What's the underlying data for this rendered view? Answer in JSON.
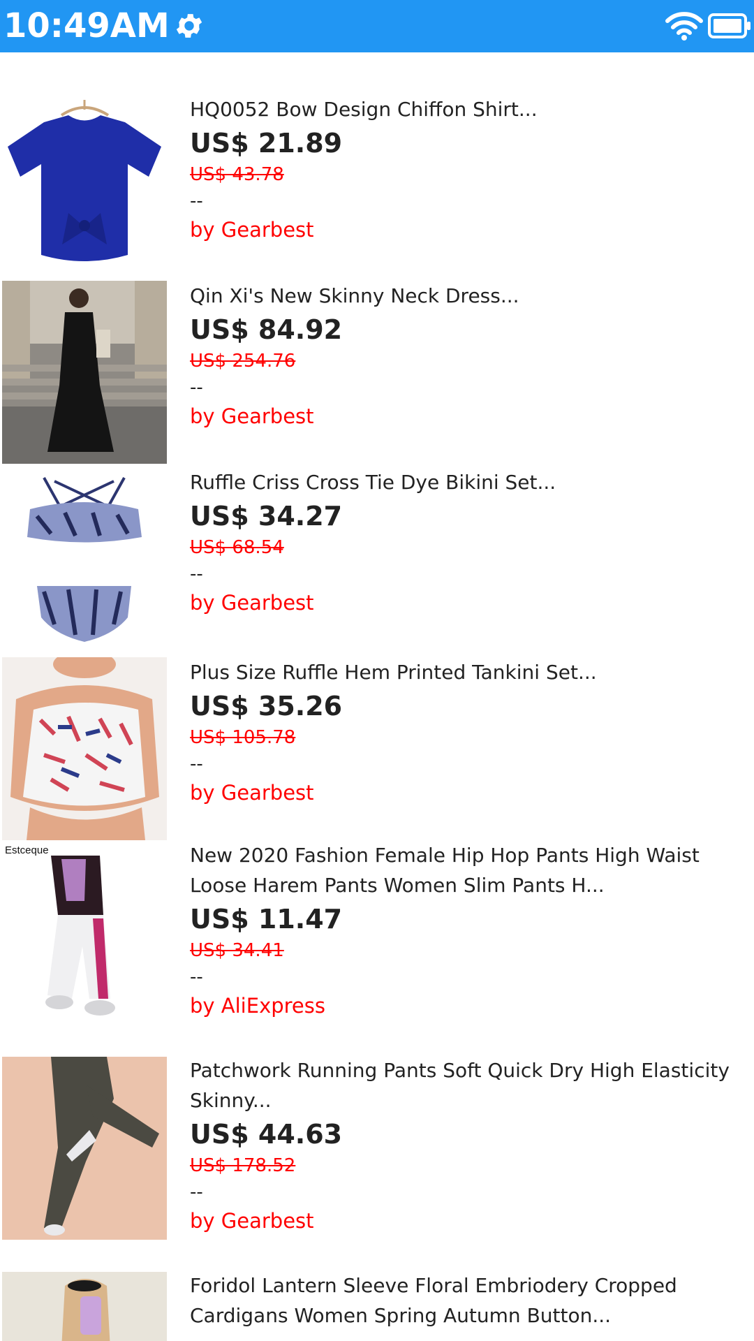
{
  "status_bar": {
    "time": "10:49AM",
    "background_color": "#2196F3",
    "icons": [
      "gear-icon",
      "wifi-icon",
      "battery-icon"
    ]
  },
  "products": [
    {
      "title": "HQ0052 Bow Design Chiffon Shirt...",
      "price": "US$ 21.89",
      "old_price": "US$ 43.78",
      "rating": "--",
      "seller": "by Gearbest",
      "image": "blue-chiffon-shirt-image"
    },
    {
      "title": "Qin Xi's New Skinny Neck Dress...",
      "price": "US$ 84.92",
      "old_price": "US$ 254.76",
      "rating": "--",
      "seller": "by Gearbest",
      "image": "black-dress-model-image"
    },
    {
      "title": "Ruffle Criss Cross Tie Dye Bikini Set...",
      "price": "US$ 34.27",
      "old_price": "US$ 68.54",
      "rating": "--",
      "seller": "by Gearbest",
      "image": "tie-dye-bikini-image"
    },
    {
      "title": "Plus Size Ruffle Hem Printed Tankini Set...",
      "price": "US$ 35.26",
      "old_price": "US$ 105.78",
      "rating": "--",
      "seller": "by Gearbest",
      "image": "printed-tankini-image"
    },
    {
      "title": "New 2020 Fashion Female Hip Hop Pants High Waist Loose Harem Pants Women Slim Pants H...",
      "price": "US$ 11.47",
      "old_price": "US$ 34.41",
      "rating": "--",
      "seller": "by AliExpress",
      "image": "hip-hop-pants-image",
      "image_text": "Estceque"
    },
    {
      "title": "Patchwork Running Pants Soft Quick Dry High Elasticity Skinny...",
      "price": "US$ 44.63",
      "old_price": "US$ 178.52",
      "rating": "--",
      "seller": "by Gearbest",
      "image": "running-pants-image"
    },
    {
      "title": "Foridol Lantern Sleeve Floral Embriodery Cropped Cardigans Women Spring Autumn Button...",
      "image": "floral-cardigan-image"
    }
  ]
}
